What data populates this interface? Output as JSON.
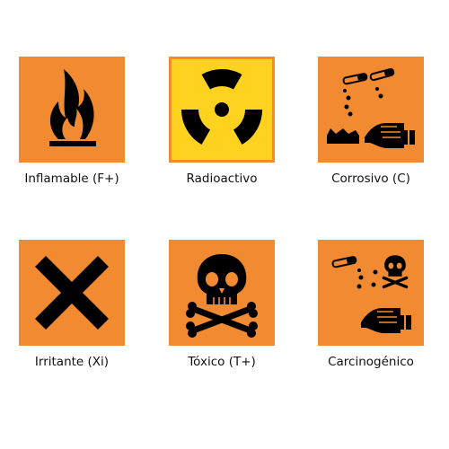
{
  "colors": {
    "hazard_orange": "#f28a32",
    "radiation_yellow": "#ffd21f",
    "symbol_black": "#000000"
  },
  "symbols": [
    {
      "label": "Inflamable (F+)",
      "icon": "flame-icon"
    },
    {
      "label": "Radioactivo",
      "icon": "radiation-icon"
    },
    {
      "label": "Corrosivo (C)",
      "icon": "corrosive-icon"
    },
    {
      "label": "Irritante (Xi)",
      "icon": "irritant-x-icon"
    },
    {
      "label": "Tóxico (T+)",
      "icon": "skull-crossbones-icon"
    },
    {
      "label": "Carcinogénico",
      "icon": "carcinogenic-icon"
    }
  ]
}
